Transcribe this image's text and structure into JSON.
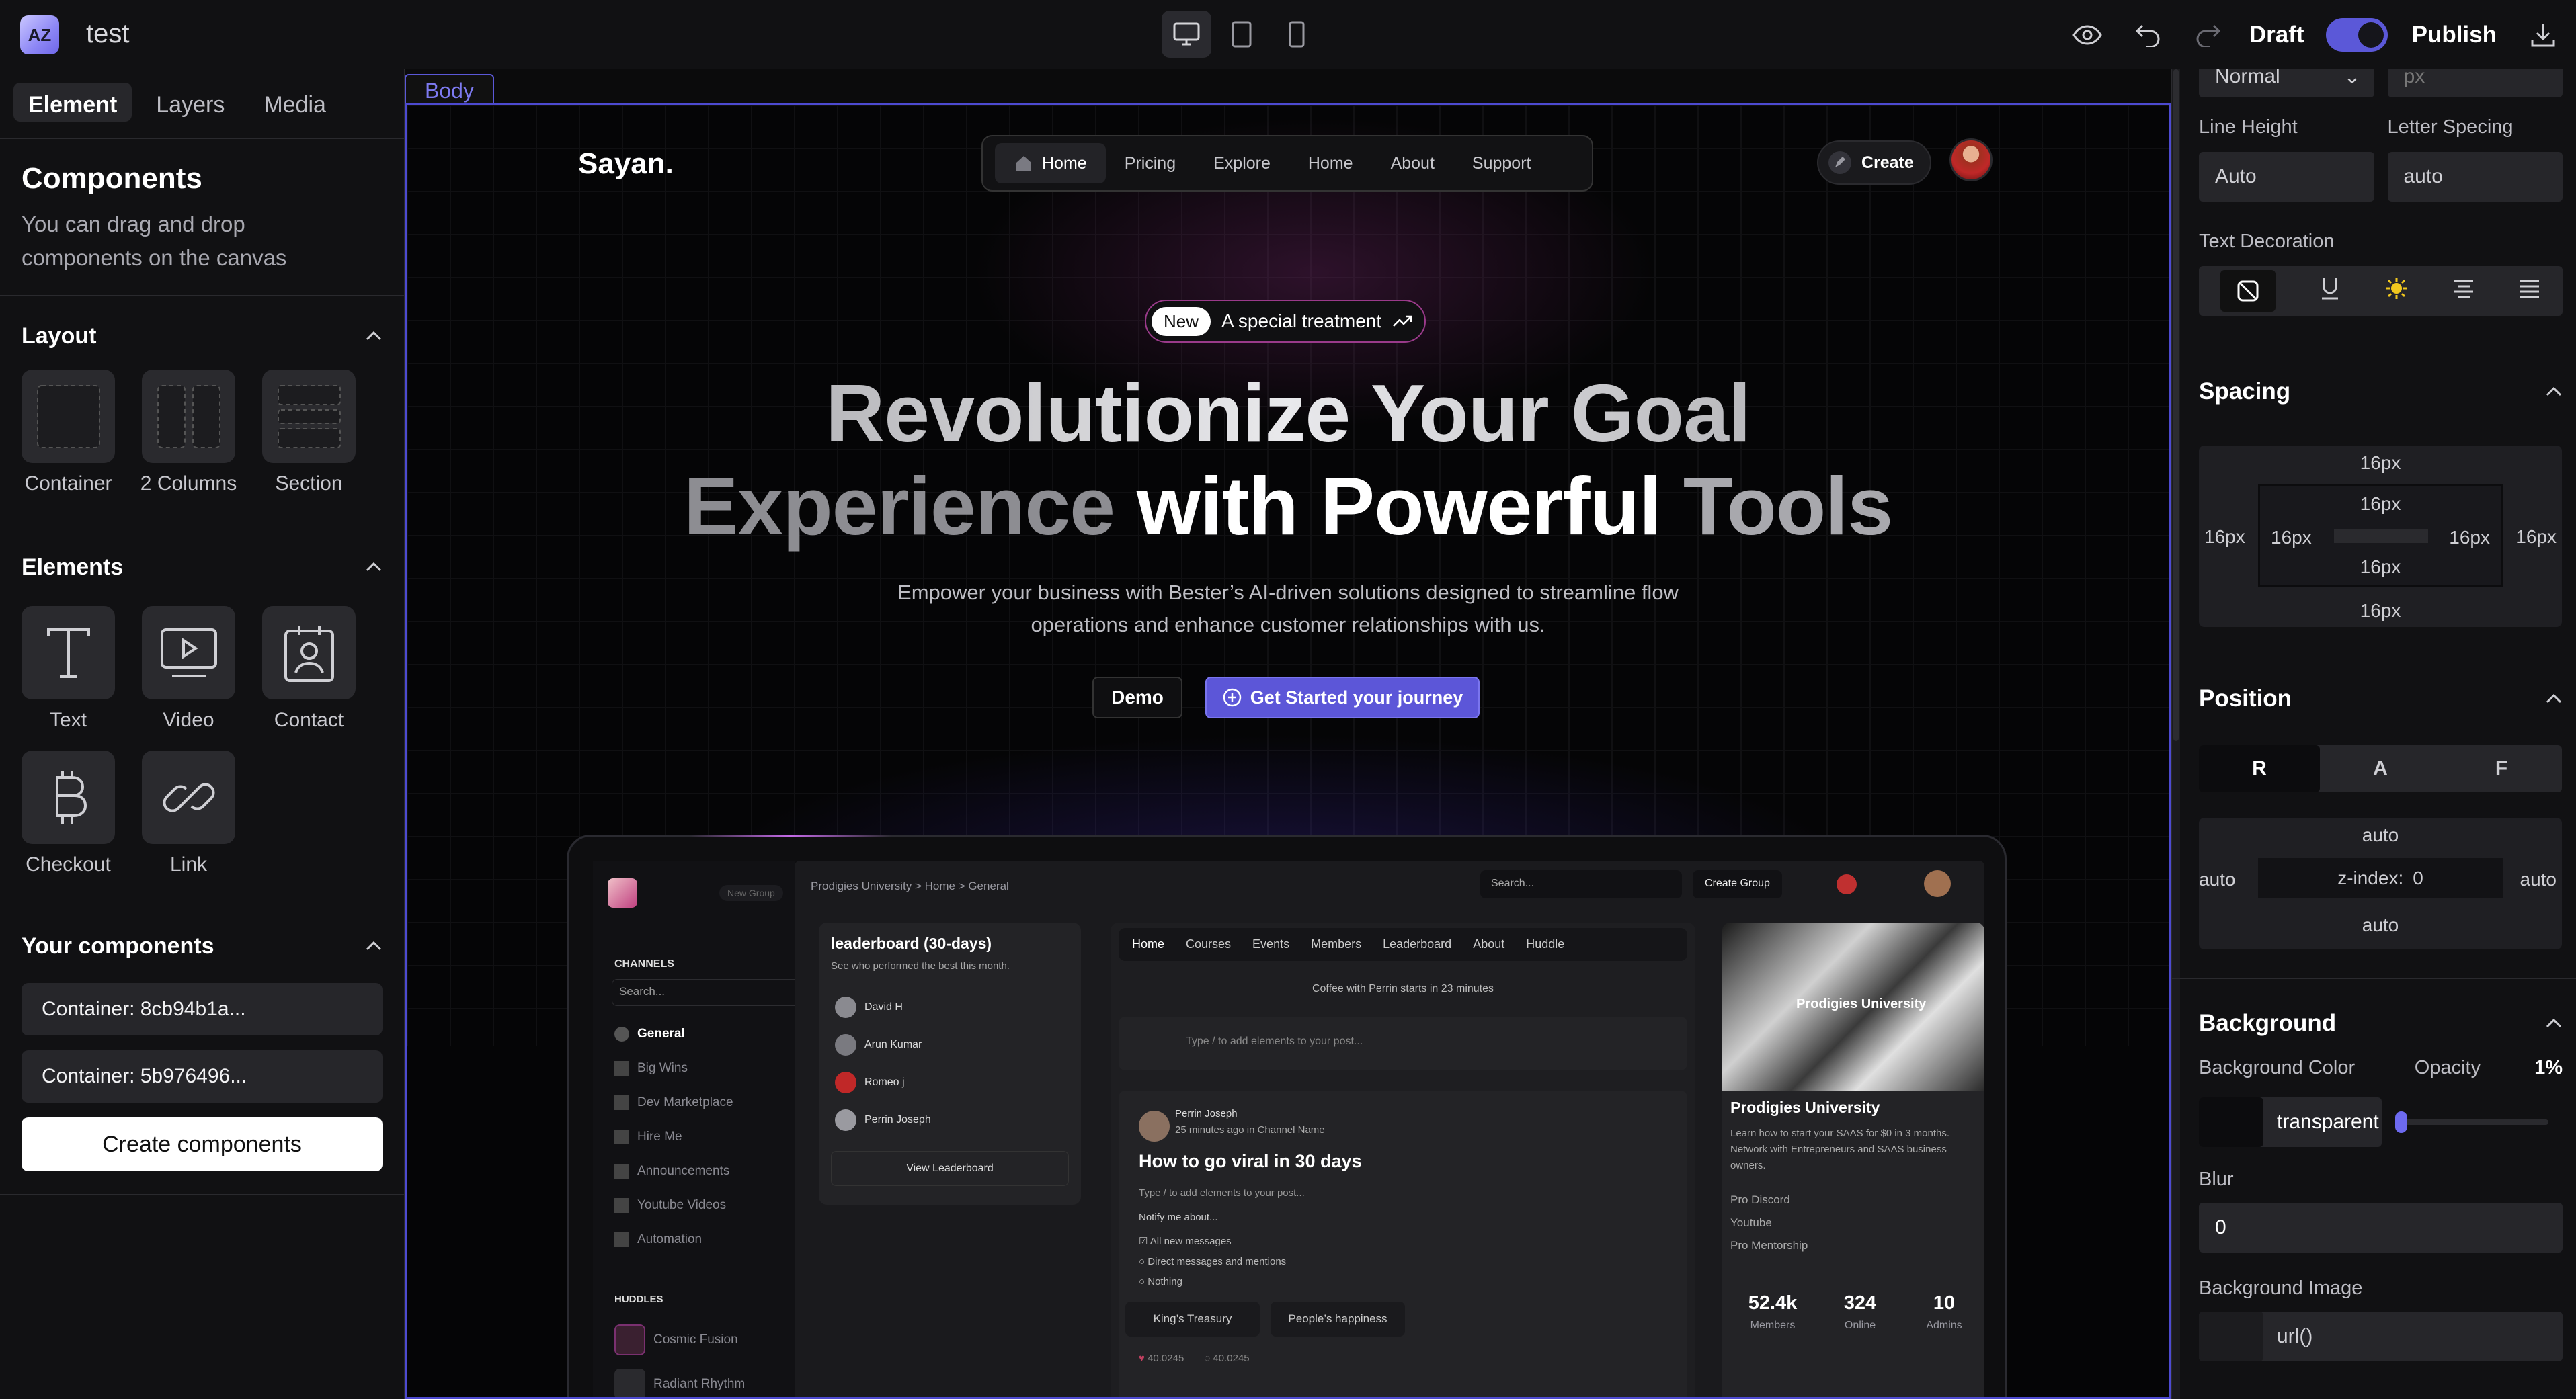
{
  "app": {
    "name": "test",
    "logo_text": "AZ"
  },
  "topbar": {
    "draft_label": "Draft",
    "publish_label": "Publish",
    "draft_toggle_on": true
  },
  "left": {
    "tabs": [
      "Element",
      "Layers",
      "Media"
    ],
    "components_title": "Components",
    "components_desc": "You can drag and drop components on the canvas",
    "layout_title": "Layout",
    "layout_items": [
      "Container",
      "2 Columns",
      "Section"
    ],
    "elements_title": "Elements",
    "element_items": [
      "Text",
      "Video",
      "Contact",
      "Checkout",
      "Link"
    ],
    "your_components_title": "Your components",
    "your_components": [
      "Container: 8cb94b1a...",
      "Container: 5b976496..."
    ],
    "create_label": "Create components"
  },
  "canvas": {
    "body_tag": "Body",
    "brand": "Sayan.",
    "nav": [
      "Home",
      "Pricing",
      "Explore",
      "Home",
      "About",
      "Support"
    ],
    "create": "Create",
    "badge_new": "New",
    "badge_text": "A special treatment",
    "hero_line1": "Revolutionize Your Goal",
    "hero_l2a": "Experience",
    "hero_l2b": "with Powerful",
    "hero_l2c": "Tools",
    "sub_line1": "Empower your business with Bester’s AI-driven solutions designed to streamline flow",
    "sub_line2": "operations and enhance customer relationships with us.",
    "demo": "Demo",
    "get_started": "Get Started your journey",
    "mock": {
      "new_group": "New Group",
      "breadcrumb": "Prodigies University  >  Home  >  General",
      "search": "Search...",
      "create_group": "Create Group",
      "channels": "CHANNELS",
      "channel_list": [
        "General",
        "Big Wins",
        "Dev Marketplace",
        "Hire Me",
        "Announcements",
        "Youtube Videos",
        "Automation"
      ],
      "huddles": "HUDDLES",
      "huddle_list": [
        "Cosmic Fusion",
        "Radiant Rhythm"
      ],
      "lb_title": "leaderboard (30-days)",
      "lb_sub": "See who performed the best this month.",
      "lb_names": [
        "David H",
        "Arun Kumar",
        "Romeo j",
        "Perrin Joseph"
      ],
      "lb_btn": "View Leaderboard",
      "tabs": [
        "Home",
        "Courses",
        "Events",
        "Members",
        "Leaderboard",
        "About",
        "Huddle"
      ],
      "coffee": "Coffee with Perrin starts in 23 minutes",
      "post_ph": "Type / to add elements to your post...",
      "author": "Perrin Joseph",
      "time": "25 minutes ago in Channel Name",
      "post_title": "How to go viral in 30 days",
      "post_ph2": "Type / to add elements to your post...",
      "notify": "Notify me about...",
      "opts": [
        "All new messages",
        "Direct messages and mentions",
        "Nothing"
      ],
      "chips": [
        "King’s Treasury",
        "People’s happiness"
      ],
      "likes": "40.0245",
      "comments": "40.0245",
      "uni_title": "Prodigies University",
      "uni_logo": "Prodigies University",
      "uni_desc": "Learn how to start your SAAS for $0 in 3 months. Network with Entrepreneurs and SAAS business owners.",
      "uni_links": [
        "Pro Discord",
        "Youtube",
        "Pro Mentorship"
      ],
      "stats": [
        {
          "v": "52.4k",
          "k": "Members"
        },
        {
          "v": "324",
          "k": "Online"
        },
        {
          "v": "10",
          "k": "Admins"
        }
      ]
    }
  },
  "right": {
    "font_style": "Normal",
    "font_unit": "px",
    "line_height_label": "Line Height",
    "line_height": "Auto",
    "letter_spacing_label": "Letter Specing",
    "letter_spacing": "auto",
    "text_decoration_label": "Text Decoration",
    "spacing_title": "Spacing",
    "spacing": {
      "outer": "16px",
      "inner": "16px"
    },
    "position_title": "Position",
    "position_tabs": [
      "R",
      "A",
      "F"
    ],
    "pos_top": "auto",
    "pos_left": "auto",
    "pos_right": "auto",
    "pos_bottom": "auto",
    "zindex_label": "z-index:",
    "zindex": "0",
    "background_title": "Background",
    "bg_color_label": "Background Color",
    "opacity_label": "Opacity",
    "opacity": "1%",
    "bg_color": "transparent",
    "blur_label": "Blur",
    "blur": "0",
    "bg_image_label": "Background Image",
    "bg_image": "url()"
  }
}
